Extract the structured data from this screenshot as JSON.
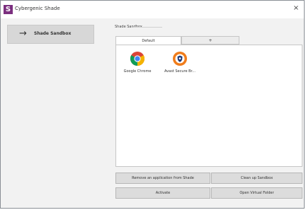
{
  "window": {
    "title": "Cybergenic Shade",
    "app_icon_letter": "S",
    "close_glyph": "×"
  },
  "sidebar": {
    "items": [
      {
        "label": "Shade Sandbox",
        "icon": "arrow-right-icon",
        "selected": true
      }
    ]
  },
  "group": {
    "legend": "Shade Sandbox"
  },
  "tabs": [
    {
      "label": "Default",
      "selected": true
    },
    {
      "label": "+",
      "selected": false
    }
  ],
  "apps": [
    {
      "label": "Google Chrome",
      "icon": "chrome-icon"
    },
    {
      "label": "Avast Secure Br...",
      "icon": "avast-secure-browser-icon"
    }
  ],
  "buttons": {
    "remove": "Remove an application from Shade",
    "cleanup": "Clean up Sandbox",
    "activate": "Activate",
    "open_virtual": "Open Virtual Folder"
  },
  "colors": {
    "app_icon_bg": "#7b2f7f",
    "selected_nav_bg": "#d7d7d7",
    "panel_bg": "#f2f2f2",
    "button_bg": "#dcdcdc",
    "avast_orange": "#f07c1b"
  }
}
